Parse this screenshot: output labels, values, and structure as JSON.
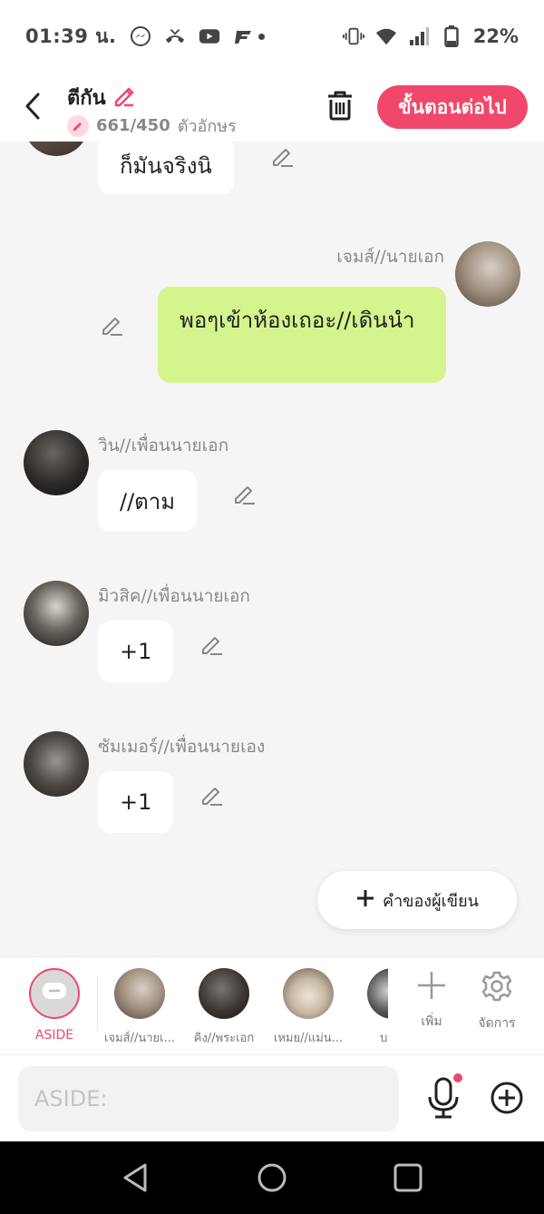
{
  "status_bar": {
    "time": "01:39 น.",
    "battery": "22%",
    "icons": [
      "messenger-icon",
      "missed-call-icon",
      "youtube-icon",
      "app-icon",
      "dot-icon",
      "vibrate-icon",
      "wifi-icon",
      "signal-icon",
      "battery-icon"
    ]
  },
  "header": {
    "title": "ตีกัน",
    "char_count": "661/450",
    "char_unit": "ตัวอักษร",
    "next_label": "ขั้นตอนต่อไป"
  },
  "messages": [
    {
      "side": "left",
      "name": "",
      "text": "ก็มันจริงนิ"
    },
    {
      "side": "right",
      "name": "เจมส์//นายเอก",
      "text": "พอๆเข้าห้องเถอะ//เดินนำ"
    },
    {
      "side": "left",
      "name": "วิน//เพื่อนนายเอก",
      "text": "//ตาม"
    },
    {
      "side": "left",
      "name": "มิวสิค//เพื่อนนายเอก",
      "text": "+1"
    },
    {
      "side": "left",
      "name": "ซัมเมอร์//เพื่อนนายเอง",
      "text": "+1"
    }
  ],
  "author_button": {
    "label": "คำของผู้เขียน"
  },
  "characters": {
    "aside": "ASIDE",
    "items": [
      {
        "label": "เจมส์//นายเ..."
      },
      {
        "label": "คิง//พระเอก"
      },
      {
        "label": "เหมย//แม่น..."
      },
      {
        "label": "บอย/"
      }
    ],
    "add_label": "เพิ่ม",
    "manage_label": "จัดการ"
  },
  "input": {
    "placeholder": "ASIDE:"
  },
  "colors": {
    "accent": "#f0476a",
    "green_bubble": "#d5f48e",
    "background": "#f5f5f5"
  }
}
